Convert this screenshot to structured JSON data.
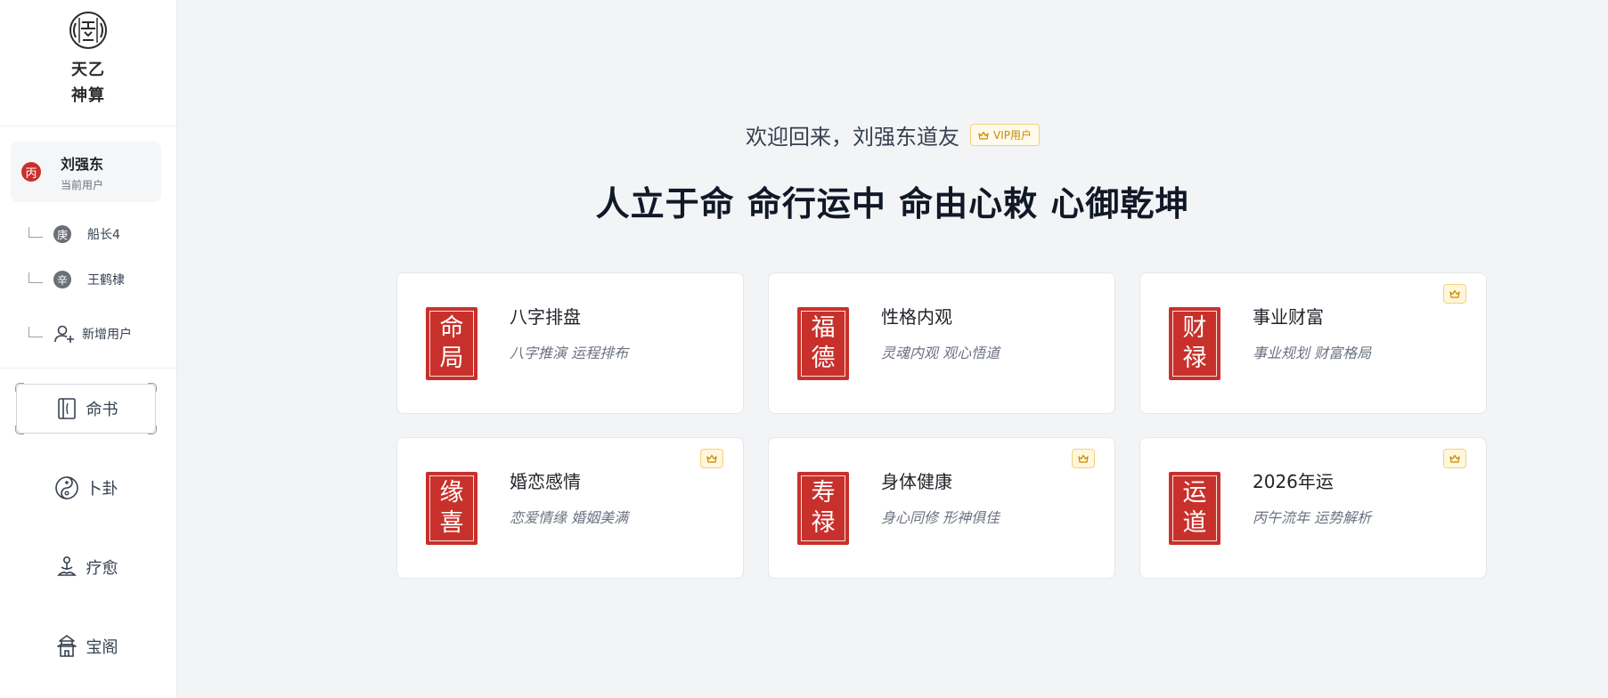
{
  "app": {
    "logo_glyph": "天乙",
    "name_line1": "天乙",
    "name_line2": "神算"
  },
  "current_user": {
    "seal": "丙",
    "name": "刘强东",
    "subtitle": "当前用户"
  },
  "sub_users": [
    {
      "seal": "庚",
      "name": "船长4"
    },
    {
      "seal": "辛",
      "name": "王鹤棣"
    }
  ],
  "add_user_label": "新增用户",
  "nav": [
    {
      "label": "命书",
      "icon": "book-icon"
    },
    {
      "label": "卜卦",
      "icon": "yin-yang-icon"
    },
    {
      "label": "疗愈",
      "icon": "meditation-icon"
    },
    {
      "label": "宝阁",
      "icon": "pagoda-icon"
    }
  ],
  "main": {
    "welcome": "欢迎回来，刘强东道友",
    "vip_label": "VIP用户",
    "motto": "人立于命 命行运中 命由心敕 心御乾坤"
  },
  "cards": [
    {
      "seal_top": "命",
      "seal_bottom": "局",
      "title": "八字排盘",
      "subtitle": "八字推演 运程排布",
      "vip": false
    },
    {
      "seal_top": "福",
      "seal_bottom": "德",
      "title": "性格内观",
      "subtitle": "灵魂内观 观心悟道",
      "vip": false
    },
    {
      "seal_top": "财",
      "seal_bottom": "禄",
      "title": "事业财富",
      "subtitle": "事业规划 财富格局",
      "vip": true
    },
    {
      "seal_top": "缘",
      "seal_bottom": "喜",
      "title": "婚恋感情",
      "subtitle": "恋爱情缘 婚姻美满",
      "vip": true
    },
    {
      "seal_top": "寿",
      "seal_bottom": "禄",
      "title": "身体健康",
      "subtitle": "身心同修 形神俱佳",
      "vip": true
    },
    {
      "seal_top": "运",
      "seal_bottom": "道",
      "title": "2026年运",
      "subtitle": "丙午流年 运势解析",
      "vip": true
    }
  ],
  "colors": {
    "seal_red": "#c8312b",
    "vip_gold": "#c98a00",
    "background": "#f3f4f6"
  }
}
